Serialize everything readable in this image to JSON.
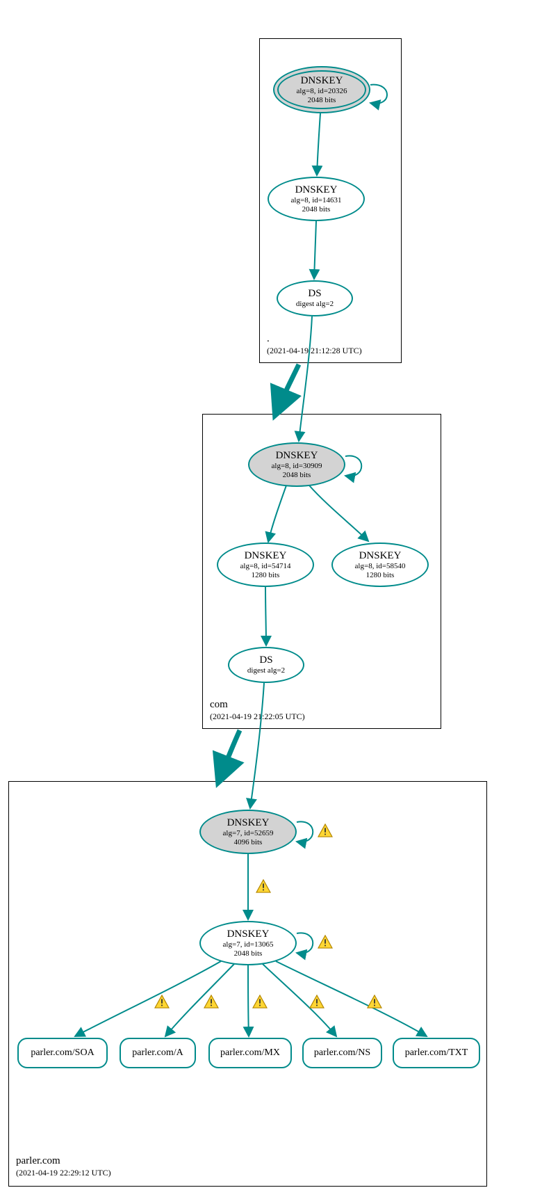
{
  "zones": {
    "root": {
      "name": ".",
      "timestamp": "(2021-04-19 21:12:28 UTC)"
    },
    "com": {
      "name": "com",
      "timestamp": "(2021-04-19 21:22:05 UTC)"
    },
    "parler": {
      "name": "parler.com",
      "timestamp": "(2021-04-19 22:29:12 UTC)"
    }
  },
  "nodes": {
    "root_ksk": {
      "title": "DNSKEY",
      "line1": "alg=8, id=20326",
      "line2": "2048 bits"
    },
    "root_zsk": {
      "title": "DNSKEY",
      "line1": "alg=8, id=14631",
      "line2": "2048 bits"
    },
    "root_ds": {
      "title": "DS",
      "line1": "digest alg=2",
      "line2": ""
    },
    "com_ksk": {
      "title": "DNSKEY",
      "line1": "alg=8, id=30909",
      "line2": "2048 bits"
    },
    "com_zsk1": {
      "title": "DNSKEY",
      "line1": "alg=8, id=54714",
      "line2": "1280 bits"
    },
    "com_zsk2": {
      "title": "DNSKEY",
      "line1": "alg=8, id=58540",
      "line2": "1280 bits"
    },
    "com_ds": {
      "title": "DS",
      "line1": "digest alg=2",
      "line2": ""
    },
    "parler_ksk": {
      "title": "DNSKEY",
      "line1": "alg=7, id=52659",
      "line2": "4096 bits"
    },
    "parler_zsk": {
      "title": "DNSKEY",
      "line1": "alg=7, id=13065",
      "line2": "2048 bits"
    }
  },
  "rr": {
    "soa": "parler.com/SOA",
    "a": "parler.com/A",
    "mx": "parler.com/MX",
    "ns": "parler.com/NS",
    "txt": "parler.com/TXT"
  },
  "colors": {
    "stroke": "#008b8b",
    "nodeFill": "#d3d3d3",
    "warnFill": "#ffd633",
    "warnStroke": "#b38600"
  }
}
